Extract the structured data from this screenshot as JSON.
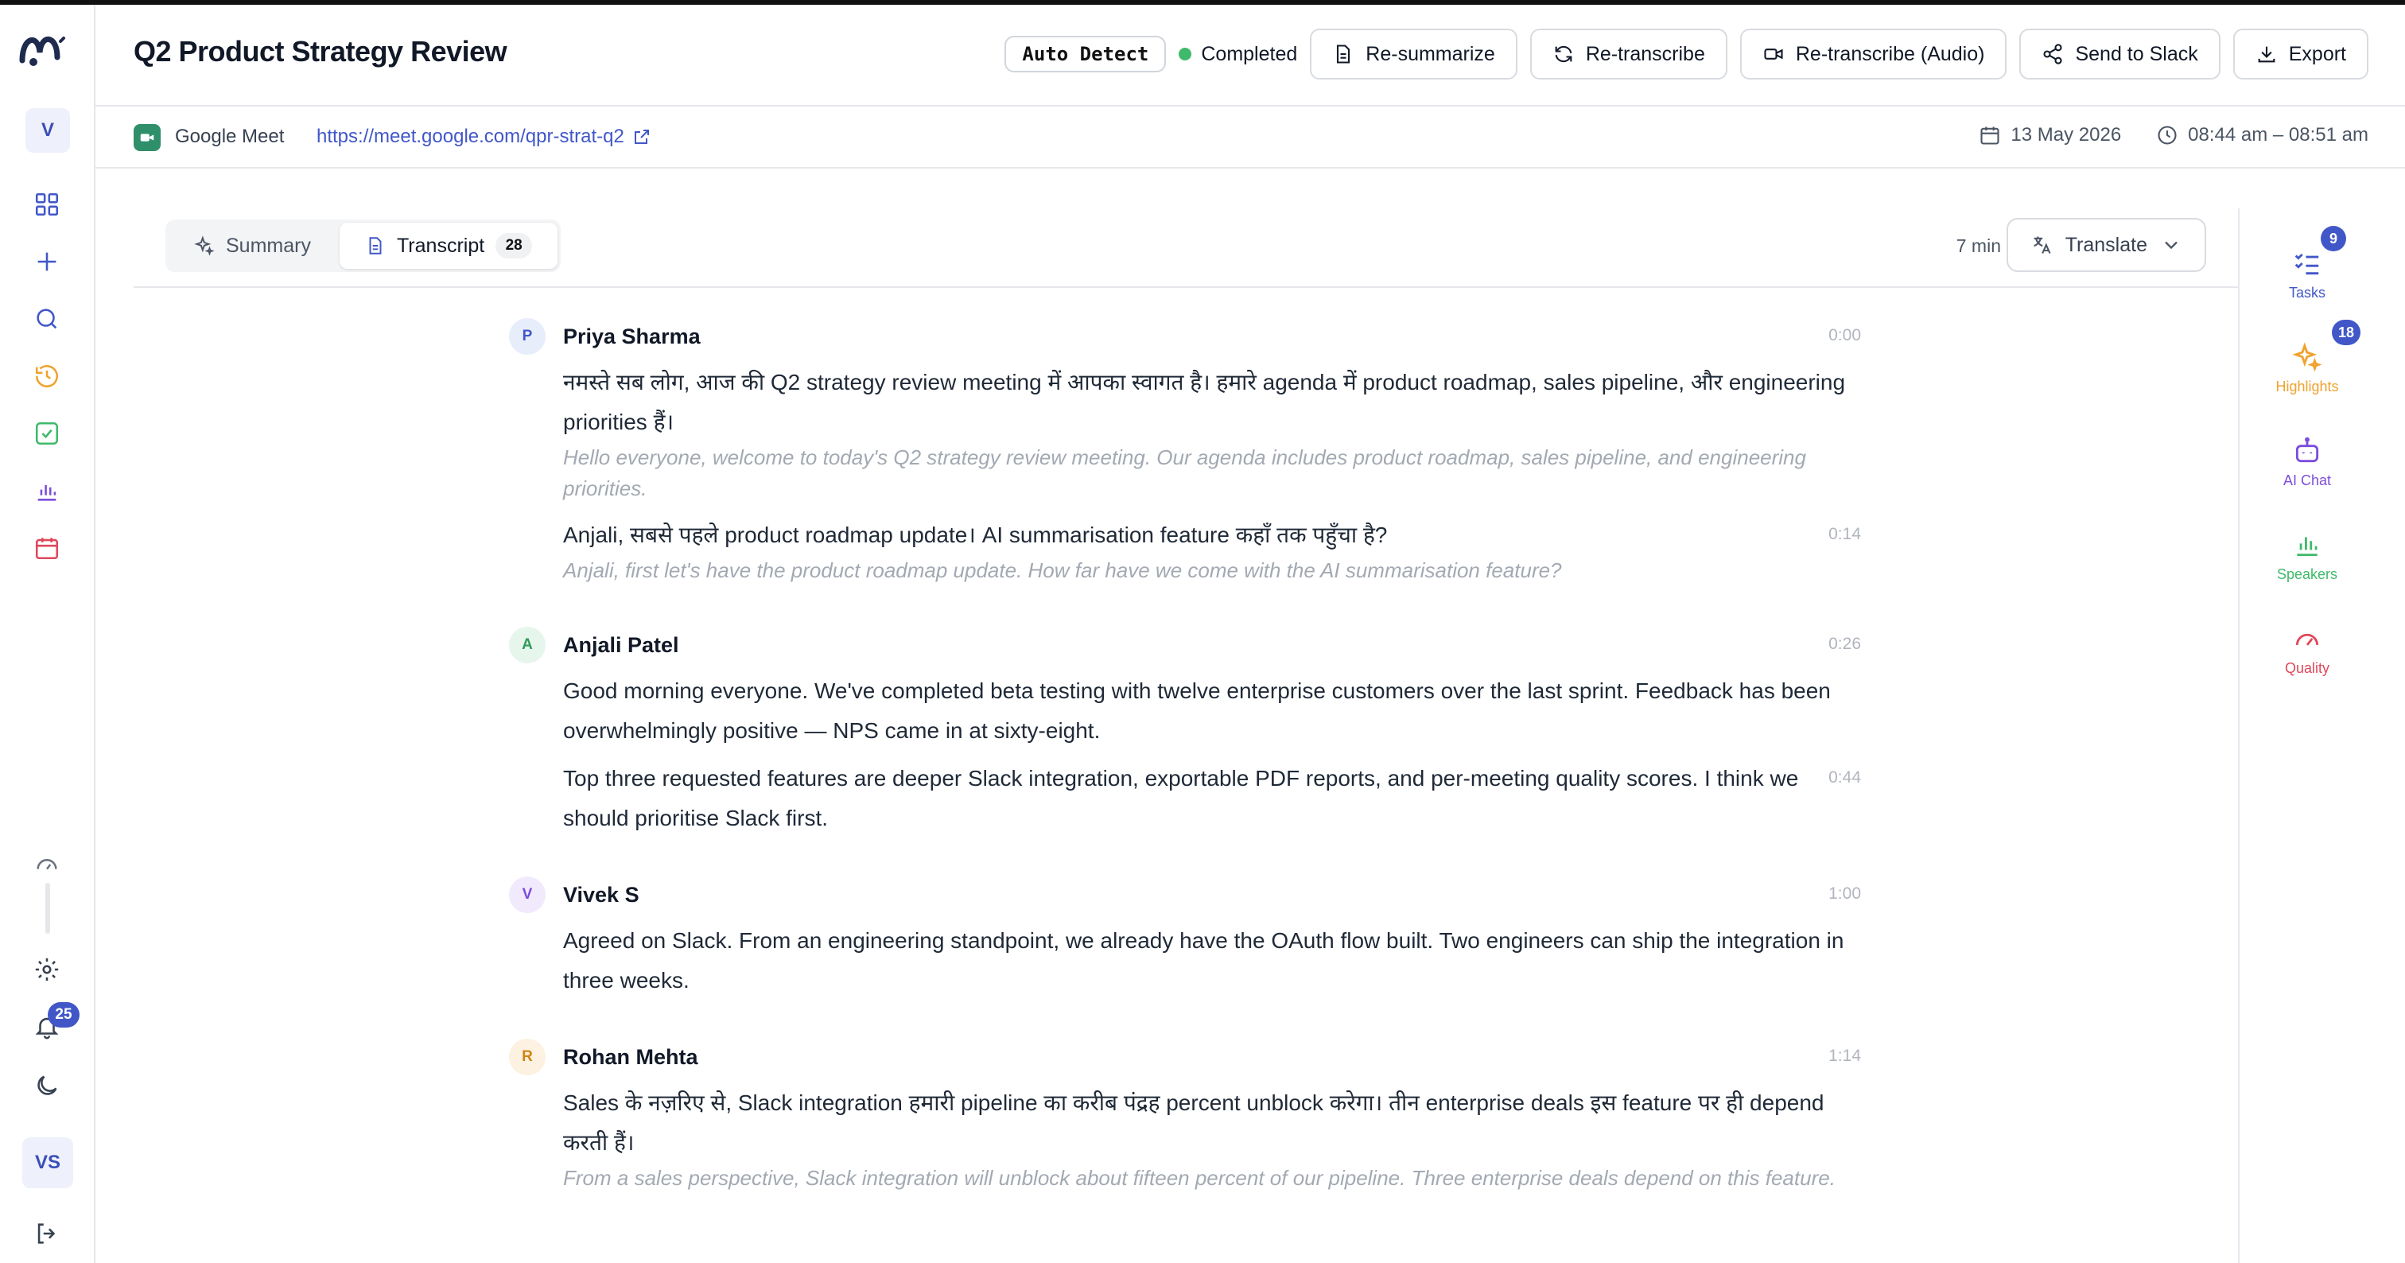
{
  "app": {
    "workspace_initial": "V",
    "user_initials": "VS",
    "notification_count": "25"
  },
  "header": {
    "title": "Q2 Product Strategy Review",
    "language": "Auto Detect",
    "status": "Completed",
    "buttons": {
      "resummarize": "Re-summarize",
      "retranscribe": "Re-transcribe",
      "retranscribe_audio": "Re-transcribe (Audio)",
      "send_slack": "Send to Slack",
      "export": "Export"
    }
  },
  "meta": {
    "platform": "Google Meet",
    "url": "https://meet.google.com/qpr-strat-q2",
    "date": "13 May 2026",
    "time_range": "08:44 am – 08:51 am"
  },
  "tabs": {
    "summary": "Summary",
    "transcript": "Transcript",
    "transcript_count": "28",
    "duration": "7 min",
    "translate": "Translate"
  },
  "transcript": [
    {
      "initial": "P",
      "speaker": "Priya Sharma",
      "segments": [
        {
          "time": "0:00",
          "text": "नमस्ते सब लोग, आज की Q2 strategy review meeting में आपका स्वागत है। हमारे agenda में product roadmap, sales pipeline, और engineering priorities हैं।",
          "translation": "Hello everyone, welcome to today's Q2 strategy review meeting. Our agenda includes product roadmap, sales pipeline, and engineering priorities."
        },
        {
          "time": "0:14",
          "text": "Anjali, सबसे पहले product roadmap update। AI summarisation feature कहाँ तक पहुँचा है?",
          "translation": "Anjali, first let's have the product roadmap update. How far have we come with the AI summarisation feature?"
        }
      ]
    },
    {
      "initial": "A",
      "speaker": "Anjali Patel",
      "segments": [
        {
          "time": "0:26",
          "text": "Good morning everyone. We've completed beta testing with twelve enterprise customers over the last sprint. Feedback has been overwhelmingly positive — NPS came in at sixty-eight."
        },
        {
          "time": "0:44",
          "text": "Top three requested features are deeper Slack integration, exportable PDF reports, and per-meeting quality scores. I think we should prioritise Slack first."
        }
      ]
    },
    {
      "initial": "V",
      "speaker": "Vivek S",
      "segments": [
        {
          "time": "1:00",
          "text": "Agreed on Slack. From an engineering standpoint, we already have the OAuth flow built. Two engineers can ship the integration in three weeks."
        }
      ]
    },
    {
      "initial": "R",
      "speaker": "Rohan Mehta",
      "segments": [
        {
          "time": "1:14",
          "text": "Sales के नज़रिए से, Slack integration हमारी pipeline का करीब पंद्रह percent unblock करेगा। तीन enterprise deals इस feature पर ही depend करती हैं।",
          "translation": "From a sales perspective, Slack integration will unblock about fifteen percent of our pipeline. Three enterprise deals depend on this feature."
        }
      ]
    }
  ],
  "rail": {
    "tasks": "Tasks",
    "tasks_count": "9",
    "highlights": "Highlights",
    "highlights_count": "18",
    "ai_chat": "AI Chat",
    "speakers": "Speakers",
    "quality": "Quality"
  },
  "colors": {
    "accent": "#4157c8",
    "status_green": "#3fb96b",
    "highlights": "#f0a22e",
    "ai_chat": "#7c4ddb",
    "speakers": "#3fb96b",
    "quality": "#e0475b"
  }
}
